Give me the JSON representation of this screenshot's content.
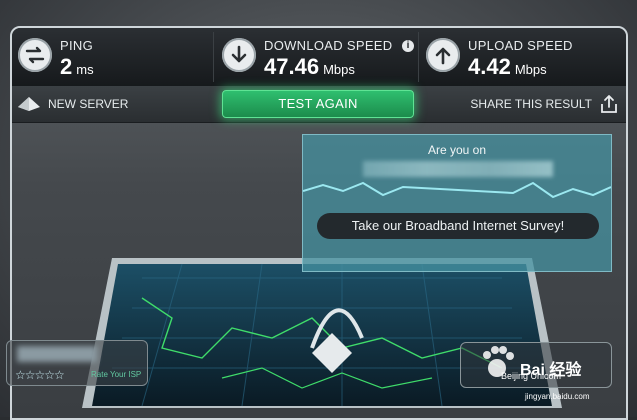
{
  "stats": {
    "ping": {
      "label": "PING",
      "value": "2",
      "unit": "ms",
      "icon": "arrows-exchange-icon"
    },
    "download": {
      "label": "DOWNLOAD SPEED",
      "value": "47.46",
      "unit": "Mbps",
      "icon": "down-arrow-icon"
    },
    "upload": {
      "label": "UPLOAD SPEED",
      "value": "4.42",
      "unit": "Mbps",
      "icon": "up-arrow-icon"
    },
    "info_glyph": "i"
  },
  "actions": {
    "new_server": "NEW SERVER",
    "test_again": "TEST AGAIN",
    "share": "SHARE THIS RESULT"
  },
  "survey": {
    "title": "Are you on",
    "cta": "Take our Broadband Internet Survey!"
  },
  "isp": {
    "stars": "☆☆☆☆☆",
    "rate": "Rate Your ISP",
    "server": "Beijing Unicom"
  },
  "watermark": {
    "brand": "Bai 经验",
    "url": "jingyan.baidu.com"
  },
  "colors": {
    "accent": "#2fbf6f",
    "panel": "#45494d",
    "survey": "#4691a0"
  }
}
